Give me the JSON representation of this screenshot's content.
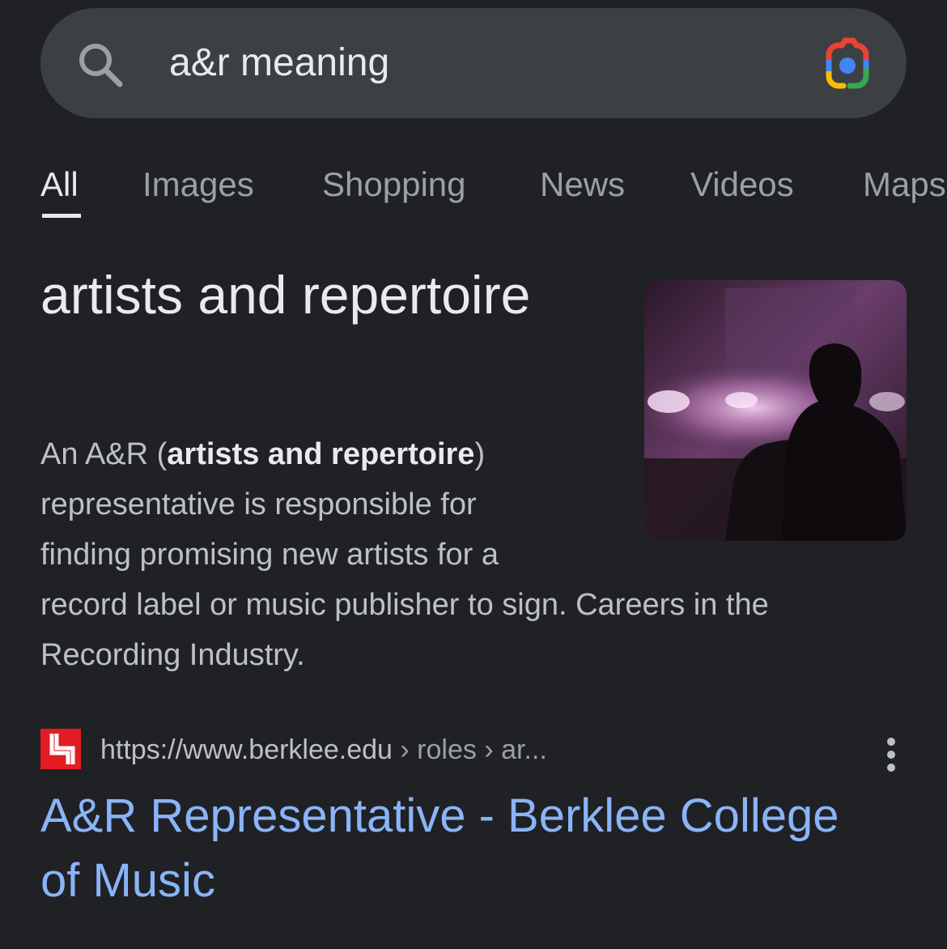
{
  "search": {
    "query": "a&r meaning"
  },
  "tabs": [
    {
      "label": "All",
      "active": true
    },
    {
      "label": "Images",
      "active": false
    },
    {
      "label": "Shopping",
      "active": false
    },
    {
      "label": "News",
      "active": false
    },
    {
      "label": "Videos",
      "active": false
    },
    {
      "label": "Maps",
      "active": false
    }
  ],
  "knowledge_panel": {
    "title": "artists and repertoire",
    "image_description": "silhouette of a person watching a concert stage in purple light",
    "description": {
      "line1_prefix": "An A&R (",
      "line1_bold": "artists and repertoire",
      "line1_suffix": ")",
      "line2": "representative is responsible for",
      "line3": "finding promising new artists for a",
      "line4": "record label or music publisher to sign. Careers in the",
      "line5": "Recording Industry."
    }
  },
  "result": {
    "url_base": "https://www.berklee.edu",
    "url_crumbs": " › roles › ar...",
    "title_line1": "A&R Representative - Berklee College",
    "title_line2": "of Music"
  },
  "colors": {
    "background": "#202124",
    "search_bar": "#3c4043",
    "link": "#8ab4f8",
    "favicon": "#e31b23"
  },
  "icons": {
    "search": "search-icon",
    "lens": "google-lens-icon",
    "favicon": "berklee-logo-icon",
    "more": "more-vertical-icon"
  }
}
